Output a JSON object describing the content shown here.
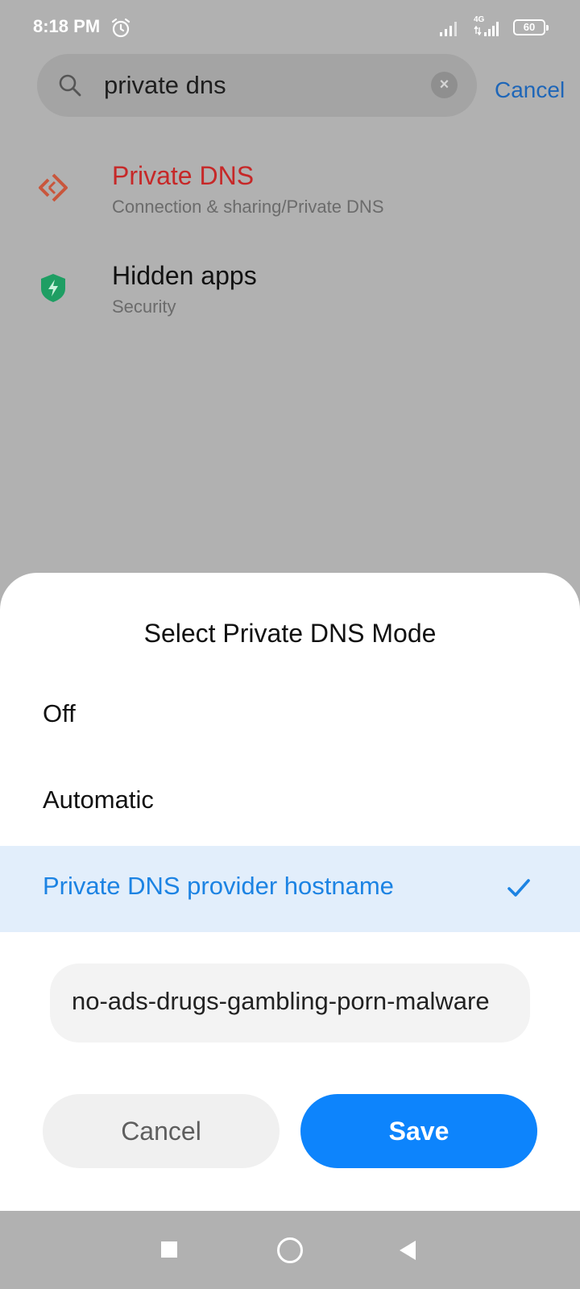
{
  "status_bar": {
    "time": "8:18 PM",
    "network": "4G",
    "battery": "60"
  },
  "search": {
    "query": "private dns",
    "cancel_label": "Cancel"
  },
  "results": [
    {
      "title": "Private DNS",
      "subtitle": "Connection & sharing/Private DNS",
      "icon": "private-dns-icon",
      "title_color": "#c62828"
    },
    {
      "title": "Hidden apps",
      "subtitle": "Security",
      "icon": "shield-icon",
      "title_color": "#111111"
    }
  ],
  "dialog": {
    "title": "Select Private DNS Mode",
    "options": [
      {
        "label": "Off",
        "selected": false
      },
      {
        "label": "Automatic",
        "selected": false
      },
      {
        "label": "Private DNS provider hostname",
        "selected": true
      }
    ],
    "hostname_value": "no-ads-drugs-gambling-porn-malware",
    "cancel_label": "Cancel",
    "save_label": "Save"
  },
  "colors": {
    "accent": "#0d84fc",
    "selected_bg": "#e2eefb",
    "link": "#1e66b8"
  }
}
